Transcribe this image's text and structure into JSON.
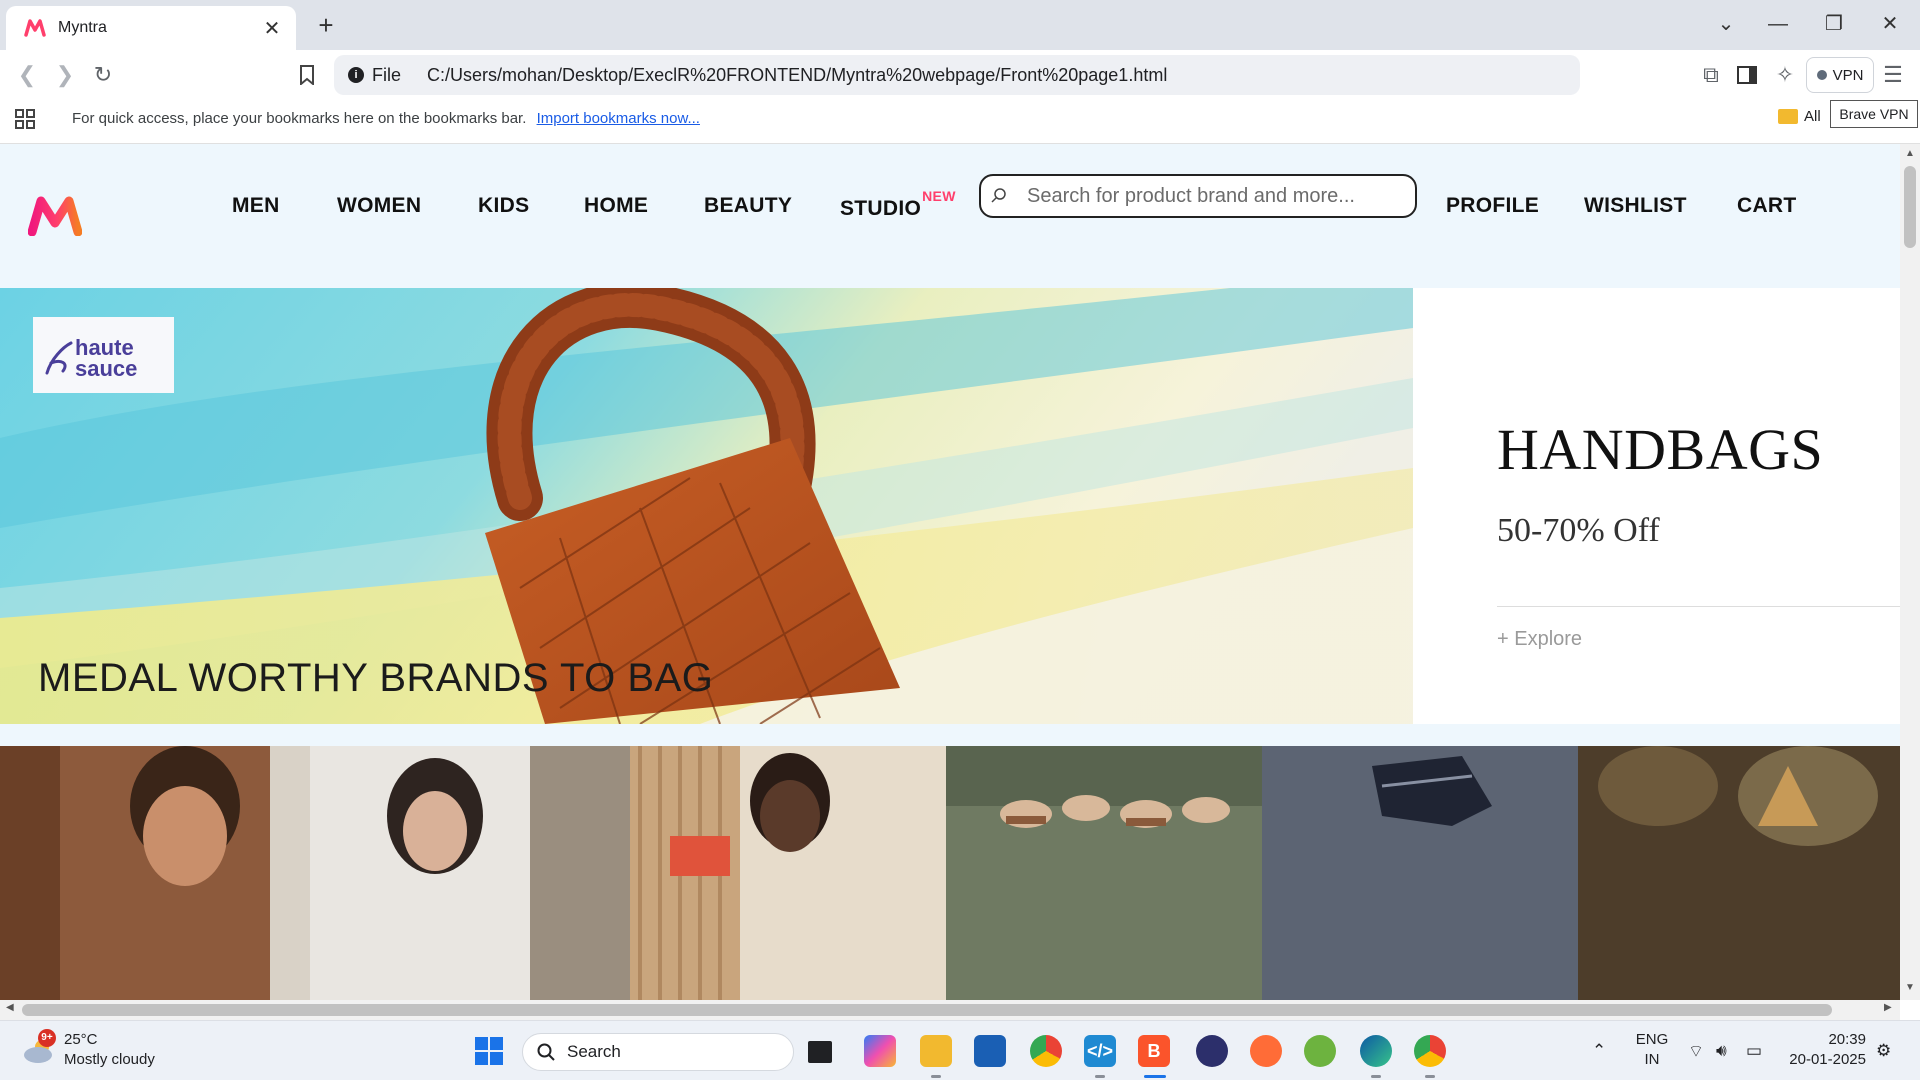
{
  "browser": {
    "tab_title": "Myntra",
    "address_scheme": "File",
    "address_url": "C:/Users/mohan/Desktop/ExeclR%20FRONTEND/Myntra%20webpage/Front%20page1.html",
    "vpn_label": "VPN",
    "vpn_tooltip": "Brave VPN",
    "bookmarks_hint": "For quick access, place your bookmarks here on the bookmarks bar.",
    "import_link": "Import bookmarks now...",
    "all_bookmarks": "All"
  },
  "site": {
    "brand_color": "#ff3f6c",
    "nav": [
      {
        "label": "MEN"
      },
      {
        "label": "WOMEN"
      },
      {
        "label": "KIDS"
      },
      {
        "label": "HOME"
      },
      {
        "label": "BEAUTY"
      },
      {
        "label": "STUDIO",
        "badge": "NEW"
      }
    ],
    "search_placeholder": "Search for product brand and more...",
    "actions": [
      {
        "label": "PROFILE"
      },
      {
        "label": "WISHLIST"
      },
      {
        "label": "CART"
      }
    ],
    "banner": {
      "brand_logo_text": "haute sauce",
      "title": "HANDBAGS",
      "subtitle": "50-70% Off",
      "cta": "+ Explore"
    },
    "section_title": "MEDAL WORTHY BRANDS TO BAG"
  },
  "taskbar": {
    "weather_badge": "9+",
    "temperature": "25°C",
    "weather": "Mostly cloudy",
    "search_label": "Search",
    "language": "ENG",
    "region": "IN",
    "time": "20:39",
    "date": "20-01-2025"
  }
}
